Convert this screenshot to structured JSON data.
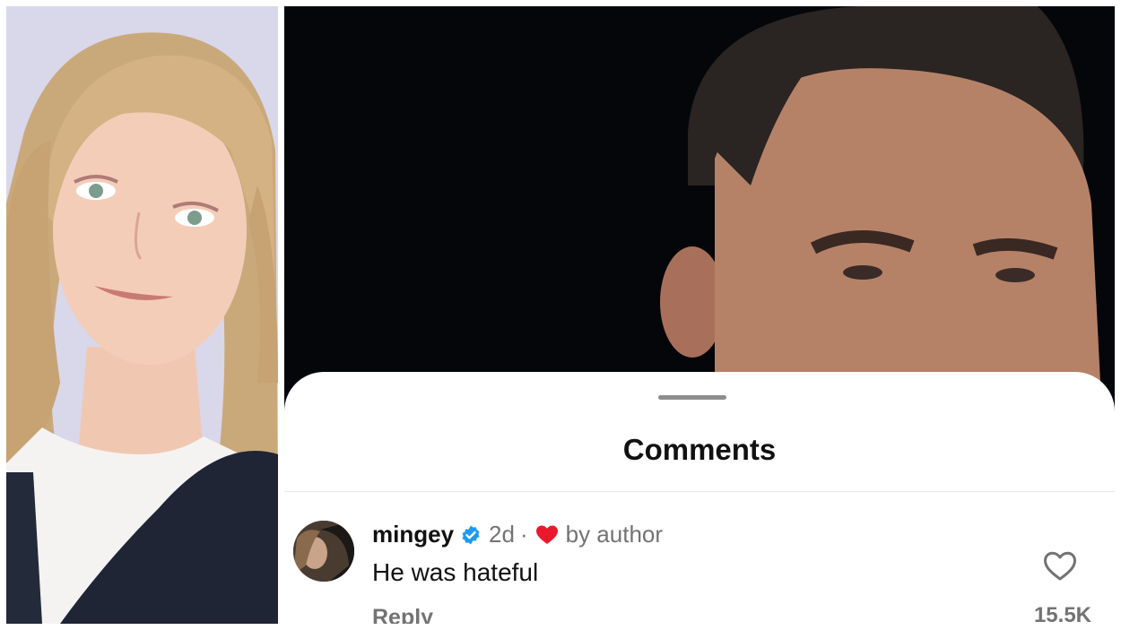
{
  "photos": {
    "left": {
      "subject": "woman-portrait-photo"
    },
    "right": {
      "subject": "man-portrait-photo"
    }
  },
  "sheet": {
    "title": "Comments"
  },
  "comment": {
    "username": "mingey",
    "time": "2d",
    "separator": "·",
    "liked_by": "by author",
    "text": "He was hateful",
    "reply_label": "Reply",
    "like_count": "15.5K",
    "verified": true
  },
  "colors": {
    "verified_badge": "#1d9bf0",
    "author_heart": "#e8192c",
    "secondary_text": "#737373"
  },
  "icons": [
    "verified-badge-icon",
    "heart-icon",
    "heart-outline-icon"
  ]
}
